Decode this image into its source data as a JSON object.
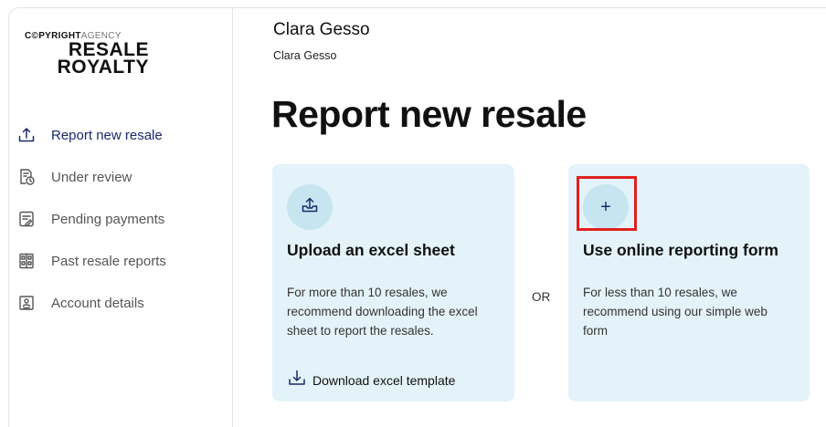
{
  "logo": {
    "copy": "C©PY",
    "right": "RIGHT",
    "agency": "AGENCY",
    "line1": "RESALE",
    "line2": "ROYALTY"
  },
  "nav": {
    "items": [
      {
        "label": "Report new resale",
        "icon": "upload-tray-icon",
        "active": true
      },
      {
        "label": "Under review",
        "icon": "document-clock-icon"
      },
      {
        "label": "Pending payments",
        "icon": "document-pen-icon"
      },
      {
        "label": "Past resale reports",
        "icon": "archive-drawers-icon"
      },
      {
        "label": "Account details",
        "icon": "id-card-icon"
      }
    ]
  },
  "user": {
    "name": "Clara Gesso",
    "subtitle": "Clara Gesso"
  },
  "page": {
    "title": "Report new resale",
    "or": "OR"
  },
  "cards": {
    "upload": {
      "icon": "upload-tray-icon",
      "title": "Upload an excel sheet",
      "description": "For more than 10 resales, we recommend downloading the excel sheet to report the resales.",
      "link": "Download excel template",
      "link_icon": "download-tray-icon"
    },
    "online": {
      "icon": "plus-icon",
      "symbol": "+",
      "title": "Use online reporting form",
      "description": "For less than 10 resales, we recommend using our simple web form"
    }
  },
  "colors": {
    "accent": "#1b2a6b",
    "card_bg": "#e4f3f9",
    "circle_bg": "#c6e5f1",
    "highlight": "#e0201e"
  }
}
